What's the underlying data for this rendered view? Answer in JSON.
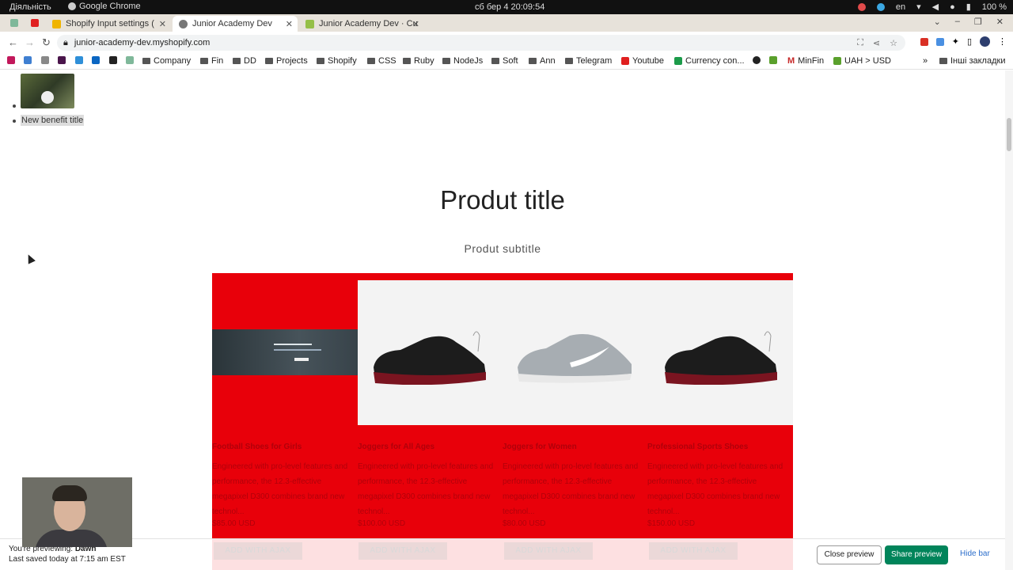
{
  "os": {
    "activities": "Діяльність",
    "app_name": "Google Chrome",
    "clock": "сб бер 4  20:09:54",
    "lang": "en",
    "battery": "100 %"
  },
  "tabs": [
    {
      "label": "Shopify Input settings (",
      "active": false
    },
    {
      "label": "Junior Academy Dev",
      "active": true
    },
    {
      "label": "Junior Academy Dev · Cu",
      "active": false
    }
  ],
  "address": {
    "url": "junior-academy-dev.myshopify.com"
  },
  "bookmarks": [
    {
      "label": "Company"
    },
    {
      "label": "Fin"
    },
    {
      "label": "DD"
    },
    {
      "label": "Projects"
    },
    {
      "label": "Shopify"
    },
    {
      "label": "CSS"
    },
    {
      "label": "Ruby"
    },
    {
      "label": "NodeJs"
    },
    {
      "label": "Soft"
    },
    {
      "label": "Ann"
    },
    {
      "label": "Telegram"
    },
    {
      "label": "Youtube"
    },
    {
      "label": "Currency con..."
    },
    {
      "label": "MinFin"
    },
    {
      "label": "UAH > USD"
    },
    {
      "label": "Інші закладки"
    }
  ],
  "page": {
    "benefit_title": "New benefit title",
    "product_title": "Produt title",
    "product_subtitle": "Produt subtitle",
    "cards": [
      {
        "title": "Football Shoes for Girls",
        "desc": "Engineered with pro-level features and performance, the 12.3-effective megapixel D300 combines brand new technol...",
        "price": "$85.00 USD",
        "ajax": "ADD WITH AJAX"
      },
      {
        "title": "Joggers for All Ages",
        "desc": "Engineered with pro-level features and performance, the 12.3-effective megapixel D300 combines brand new technol...",
        "price": "$100.00 USD",
        "ajax": "ADD WITH AJAX"
      },
      {
        "title": "Joggers for Women",
        "desc": "Engineered with pro-level features and performance, the 12.3-effective megapixel D300 combines brand new technol...",
        "price": "$80.00 USD",
        "ajax": "ADD WITH AJAX"
      },
      {
        "title": "Professional Sports Shoes",
        "desc": "Engineered with pro-level features and performance, the 12.3-effective megapixel D300 combines brand new technol...",
        "price": "$150.00 USD",
        "ajax": "ADD WITH AJAX"
      }
    ]
  },
  "preview_bar": {
    "previewing_label": "You're previewing:",
    "theme": "Dawn",
    "last_saved": "Last saved today at 7:15 am EST",
    "close_label": "Close preview",
    "share_label": "Share preview",
    "hide_label": "Hide bar"
  },
  "colors": {
    "grid_bg": "#e8000a",
    "share_btn": "#00845a"
  }
}
